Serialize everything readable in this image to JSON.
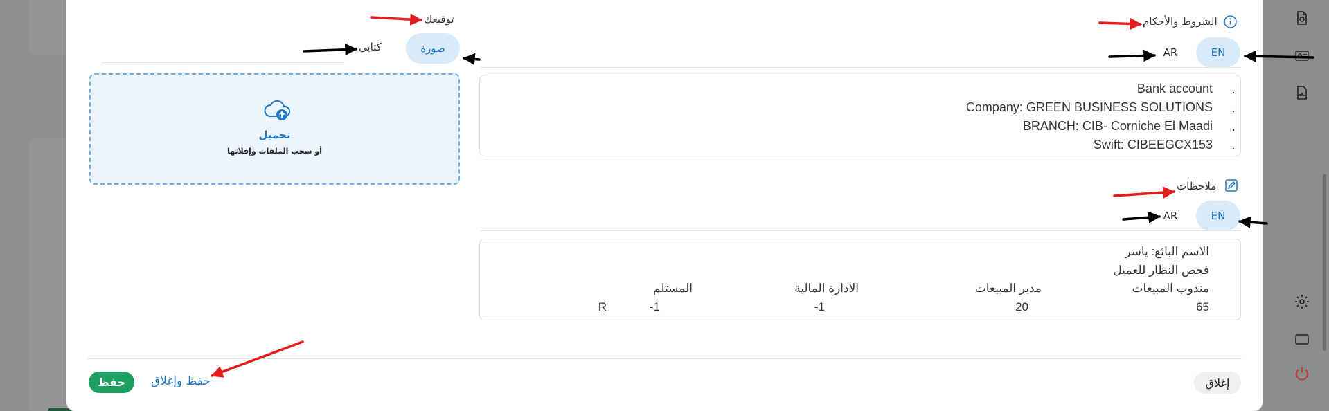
{
  "terms": {
    "title": "الشروط والأحكام",
    "lang_en": "EN",
    "lang_ar": "AR",
    "items": [
      "Bank account",
      "Company: GREEN BUSINESS SOLUTIONS",
      "BRANCH: CIB- Corniche El Maadi",
      "Swift: CIBEEGCX153"
    ]
  },
  "notes": {
    "title": "ملاحظات",
    "lang_en": "EN",
    "lang_ar": "AR",
    "line1": "الاسم البائع:  ياسر",
    "line2": "فحص النظار للعميل",
    "headers": [
      "مندوب  المبيعات",
      "مدير المبيعات",
      "الادارة المالية",
      "المستلم"
    ],
    "values": [
      "65",
      "20",
      "-1",
      "-1",
      "R"
    ]
  },
  "signature": {
    "title": "توقيعك",
    "tab_image": "صورة",
    "tab_written": "كتابي",
    "upload_label": "تحميل",
    "upload_hint": "أو سحب الملفات وإفلاتها"
  },
  "footer": {
    "close_label": "إغلاق",
    "save_close_label": "حفظ وإغلاق",
    "save_label": "حفظ"
  },
  "colors": {
    "accent": "#1f76c2",
    "save_green": "#1fa063",
    "annotation_red": "#e11d1d",
    "annotation_black": "#000000"
  }
}
